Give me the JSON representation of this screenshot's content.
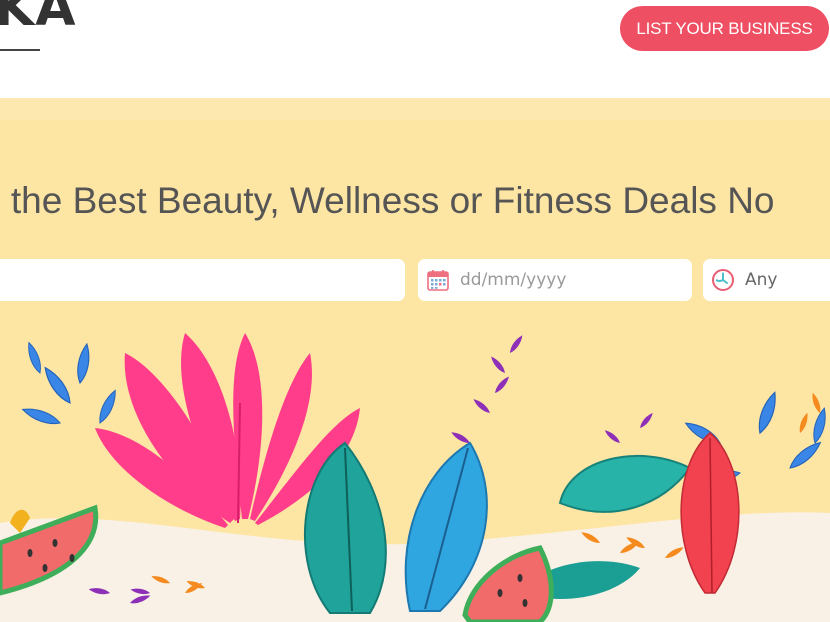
{
  "header": {
    "logo_text": "KA",
    "cta_label": "LIST YOUR BUSINESS"
  },
  "hero": {
    "headline": "d the Best Beauty, Wellness or Fitness Deals No",
    "search": {
      "placeholder": ""
    },
    "date": {
      "placeholder": "dd/mm/yyyy",
      "icon": "calendar-icon"
    },
    "time": {
      "value": "Any",
      "icon": "clock-icon"
    },
    "illustration": "tropical-leaves-and-watermelon"
  },
  "colors": {
    "accent": "#ee4f63",
    "hero_background": "#fde5a4",
    "text": "#555555"
  }
}
